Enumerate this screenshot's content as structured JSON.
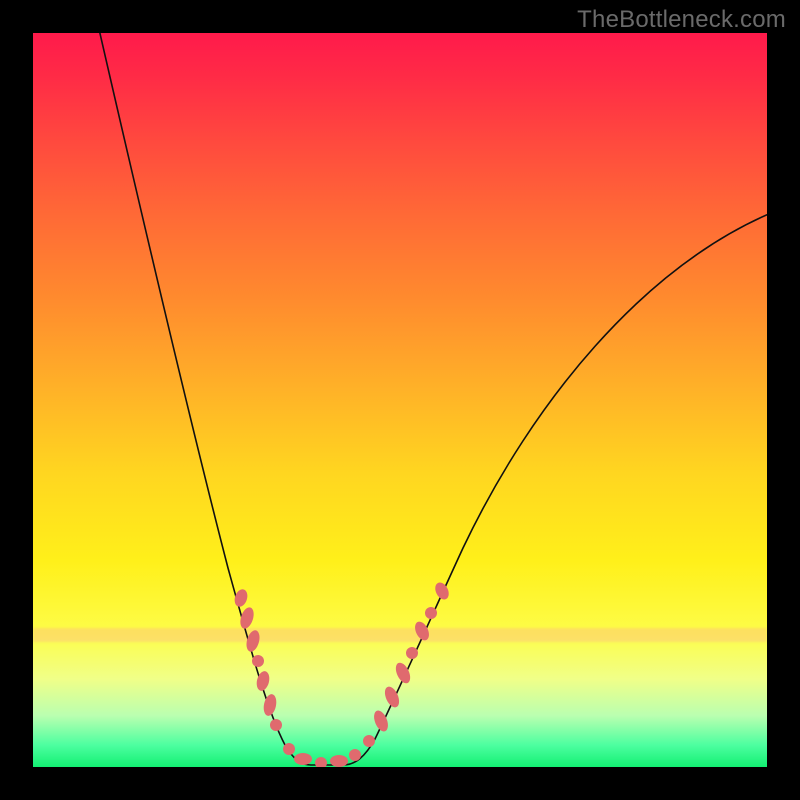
{
  "watermark": "TheBottleneck.com",
  "colors": {
    "background": "#000000",
    "curve": "#111111",
    "beads": "#e06a6e",
    "gradient_top": "#ff1a4b",
    "gradient_bottom": "#13f073"
  },
  "chart_data": {
    "type": "line",
    "title": "",
    "xlabel": "",
    "ylabel": "",
    "xlim": [
      0,
      100
    ],
    "ylim": [
      0,
      100
    ],
    "grid": false,
    "legend": false,
    "series": [
      {
        "name": "bottleneck-curve",
        "x": [
          8,
          12,
          16,
          20,
          24,
          27,
          29,
          31,
          33,
          34.5,
          36,
          38,
          40,
          42,
          44,
          46.5,
          50,
          55,
          62,
          72,
          85,
          100
        ],
        "y": [
          104,
          80,
          60,
          44,
          32,
          23,
          17,
          11,
          6,
          3,
          1,
          0.3,
          0.3,
          0.3,
          1,
          3.5,
          8,
          16,
          30,
          48,
          64,
          76
        ]
      }
    ],
    "annotations": [
      {
        "text": "TheBottleneck.com",
        "position": "top-right"
      }
    ],
    "beads_region_x": [
      27,
      56
    ],
    "background_gradient": {
      "type": "vertical",
      "stops": [
        {
          "pos": 0.0,
          "color": "#ff1a4b"
        },
        {
          "pos": 0.36,
          "color": "#ff8a2e"
        },
        {
          "pos": 0.72,
          "color": "#fff01a"
        },
        {
          "pos": 0.93,
          "color": "#baffb0"
        },
        {
          "pos": 1.0,
          "color": "#13f073"
        }
      ]
    }
  }
}
